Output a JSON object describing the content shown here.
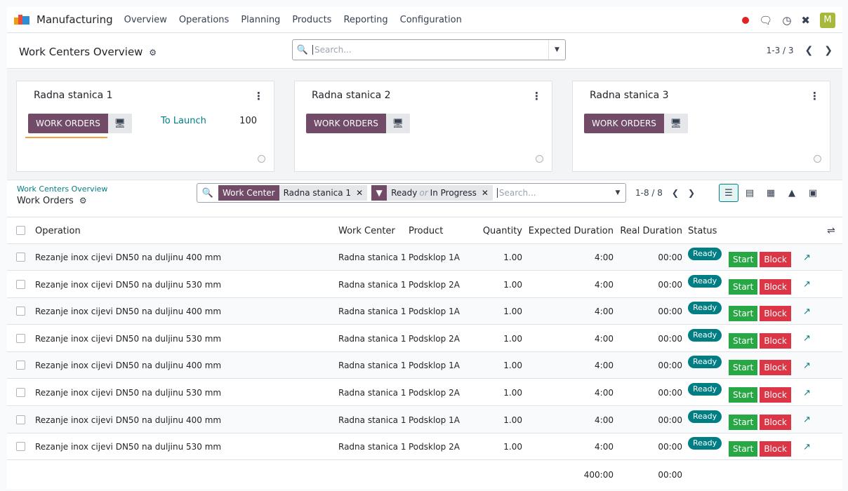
{
  "app": {
    "name": "Manufacturing",
    "menu": [
      "Overview",
      "Operations",
      "Planning",
      "Products",
      "Reporting",
      "Configuration"
    ],
    "avatar_letter": "M",
    "brand_color": "#714b67",
    "accent_color": "#017e84"
  },
  "overview": {
    "title": "Work Centers Overview",
    "search_placeholder": "Search...",
    "pager": "1-3 / 3"
  },
  "cards": [
    {
      "name": "Radna stanica 1",
      "button": "WORK ORDERS",
      "to_launch_label": "To Launch",
      "to_launch_count": "100"
    },
    {
      "name": "Radna stanica 2",
      "button": "WORK ORDERS"
    },
    {
      "name": "Radna stanica 3",
      "button": "WORK ORDERS"
    }
  ],
  "workorders": {
    "breadcrumb_parent": "Work Centers Overview",
    "title": "Work Orders",
    "facets": [
      {
        "label": "Work Center",
        "value": "Radna stanica 1"
      },
      {
        "value_a": "Ready",
        "or": "or",
        "value_b": "In Progress"
      }
    ],
    "search_placeholder": "Search...",
    "pager": "1-8 / 8",
    "columns": {
      "operation": "Operation",
      "work_center": "Work Center",
      "product": "Product",
      "quantity": "Quantity",
      "expected": "Expected Duration",
      "real": "Real Duration",
      "status": "Status"
    },
    "rows": [
      {
        "operation": "Rezanje inox cijevi DN50 na duljinu 400 mm",
        "work_center": "Radna stanica 1",
        "product": "Podsklop 1A",
        "quantity": "1.00",
        "expected": "4:00",
        "real": "00:00",
        "status": "Ready",
        "start": "Start",
        "block": "Block"
      },
      {
        "operation": "Rezanje inox cijevi DN50 na duljinu 530 mm",
        "work_center": "Radna stanica 1",
        "product": "Podsklop 2A",
        "quantity": "1.00",
        "expected": "4:00",
        "real": "00:00",
        "status": "Ready",
        "start": "Start",
        "block": "Block"
      },
      {
        "operation": "Rezanje inox cijevi DN50 na duljinu 400 mm",
        "work_center": "Radna stanica 1",
        "product": "Podsklop 1A",
        "quantity": "1.00",
        "expected": "4:00",
        "real": "00:00",
        "status": "Ready",
        "start": "Start",
        "block": "Block"
      },
      {
        "operation": "Rezanje inox cijevi DN50 na duljinu 530 mm",
        "work_center": "Radna stanica 1",
        "product": "Podsklop 2A",
        "quantity": "1.00",
        "expected": "4:00",
        "real": "00:00",
        "status": "Ready",
        "start": "Start",
        "block": "Block"
      },
      {
        "operation": "Rezanje inox cijevi DN50 na duljinu 400 mm",
        "work_center": "Radna stanica 1",
        "product": "Podsklop 1A",
        "quantity": "1.00",
        "expected": "4:00",
        "real": "00:00",
        "status": "Ready",
        "start": "Start",
        "block": "Block"
      },
      {
        "operation": "Rezanje inox cijevi DN50 na duljinu 530 mm",
        "work_center": "Radna stanica 1",
        "product": "Podsklop 2A",
        "quantity": "1.00",
        "expected": "4:00",
        "real": "00:00",
        "status": "Ready",
        "start": "Start",
        "block": "Block"
      },
      {
        "operation": "Rezanje inox cijevi DN50 na duljinu 400 mm",
        "work_center": "Radna stanica 1",
        "product": "Podsklop 1A",
        "quantity": "1.00",
        "expected": "4:00",
        "real": "00:00",
        "status": "Ready",
        "start": "Start",
        "block": "Block"
      },
      {
        "operation": "Rezanje inox cijevi DN50 na duljinu 530 mm",
        "work_center": "Radna stanica 1",
        "product": "Podsklop 2A",
        "quantity": "1.00",
        "expected": "4:00",
        "real": "00:00",
        "status": "Ready",
        "start": "Start",
        "block": "Block"
      }
    ],
    "totals": {
      "expected": "400:00",
      "real": "00:00"
    }
  }
}
